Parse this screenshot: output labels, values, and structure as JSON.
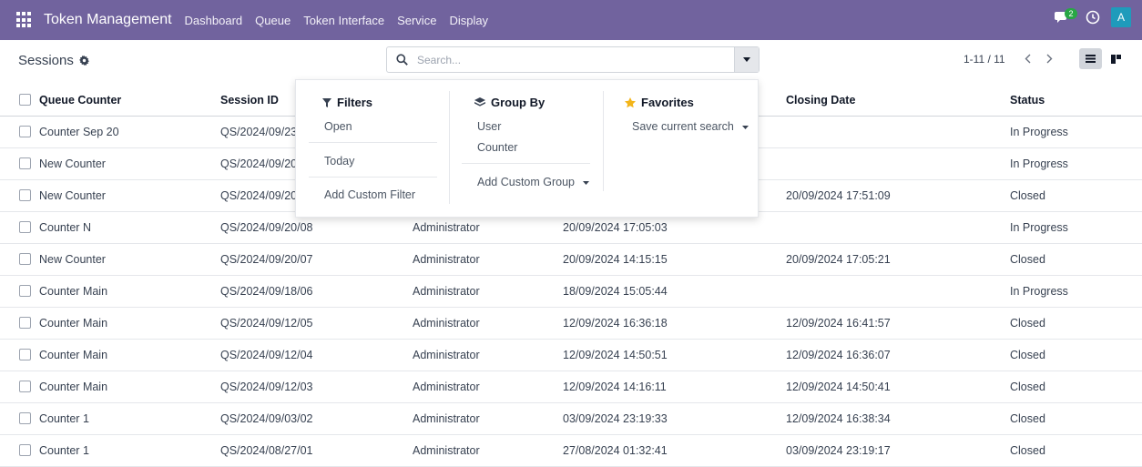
{
  "navbar": {
    "brand": "Token Management",
    "menu": [
      "Dashboard",
      "Queue",
      "Token Interface",
      "Service",
      "Display"
    ],
    "chat_badge": "2",
    "avatar": "A",
    "color": "#71639e"
  },
  "control_panel": {
    "breadcrumb": "Sessions",
    "search_placeholder": "Search...",
    "pager": "1-11 / 11"
  },
  "table": {
    "columns": [
      "Queue Counter",
      "Session ID",
      "Closing Date",
      "Status"
    ],
    "rows": [
      {
        "queue": "Counter Sep 20",
        "session": "QS/2024/09/23,",
        "user": "",
        "open": "",
        "close": "",
        "status": "In Progress"
      },
      {
        "queue": "New Counter",
        "session": "QS/2024/09/20,",
        "user": "",
        "open": "",
        "close": "",
        "status": "In Progress"
      },
      {
        "queue": "New Counter",
        "session": "QS/2024/09/20,",
        "user": "",
        "open": "",
        "close": "20/09/2024 17:51:09",
        "status": "Closed"
      },
      {
        "queue": "Counter N",
        "session": "QS/2024/09/20/08",
        "user": "Administrator",
        "open": "20/09/2024 17:05:03",
        "close": "",
        "status": "In Progress"
      },
      {
        "queue": "New Counter",
        "session": "QS/2024/09/20/07",
        "user": "Administrator",
        "open": "20/09/2024 14:15:15",
        "close": "20/09/2024 17:05:21",
        "status": "Closed"
      },
      {
        "queue": "Counter Main",
        "session": "QS/2024/09/18/06",
        "user": "Administrator",
        "open": "18/09/2024 15:05:44",
        "close": "",
        "status": "In Progress"
      },
      {
        "queue": "Counter Main",
        "session": "QS/2024/09/12/05",
        "user": "Administrator",
        "open": "12/09/2024 16:36:18",
        "close": "12/09/2024 16:41:57",
        "status": "Closed"
      },
      {
        "queue": "Counter Main",
        "session": "QS/2024/09/12/04",
        "user": "Administrator",
        "open": "12/09/2024 14:50:51",
        "close": "12/09/2024 16:36:07",
        "status": "Closed"
      },
      {
        "queue": "Counter Main",
        "session": "QS/2024/09/12/03",
        "user": "Administrator",
        "open": "12/09/2024 14:16:11",
        "close": "12/09/2024 14:50:41",
        "status": "Closed"
      },
      {
        "queue": "Counter 1",
        "session": "QS/2024/09/03/02",
        "user": "Administrator",
        "open": "03/09/2024 23:19:33",
        "close": "12/09/2024 16:38:34",
        "status": "Closed"
      },
      {
        "queue": "Counter 1",
        "session": "QS/2024/08/27/01",
        "user": "Administrator",
        "open": "27/08/2024 01:32:41",
        "close": "03/09/2024 23:19:17",
        "status": "Closed"
      }
    ]
  },
  "dropdown": {
    "filters": {
      "title": "Filters",
      "items": [
        "Open",
        "Today",
        "Add Custom Filter"
      ]
    },
    "group_by": {
      "title": "Group By",
      "items": [
        "User",
        "Counter",
        "Add Custom Group"
      ]
    },
    "favorites": {
      "title": "Favorites",
      "items": [
        "Save current search"
      ]
    }
  }
}
